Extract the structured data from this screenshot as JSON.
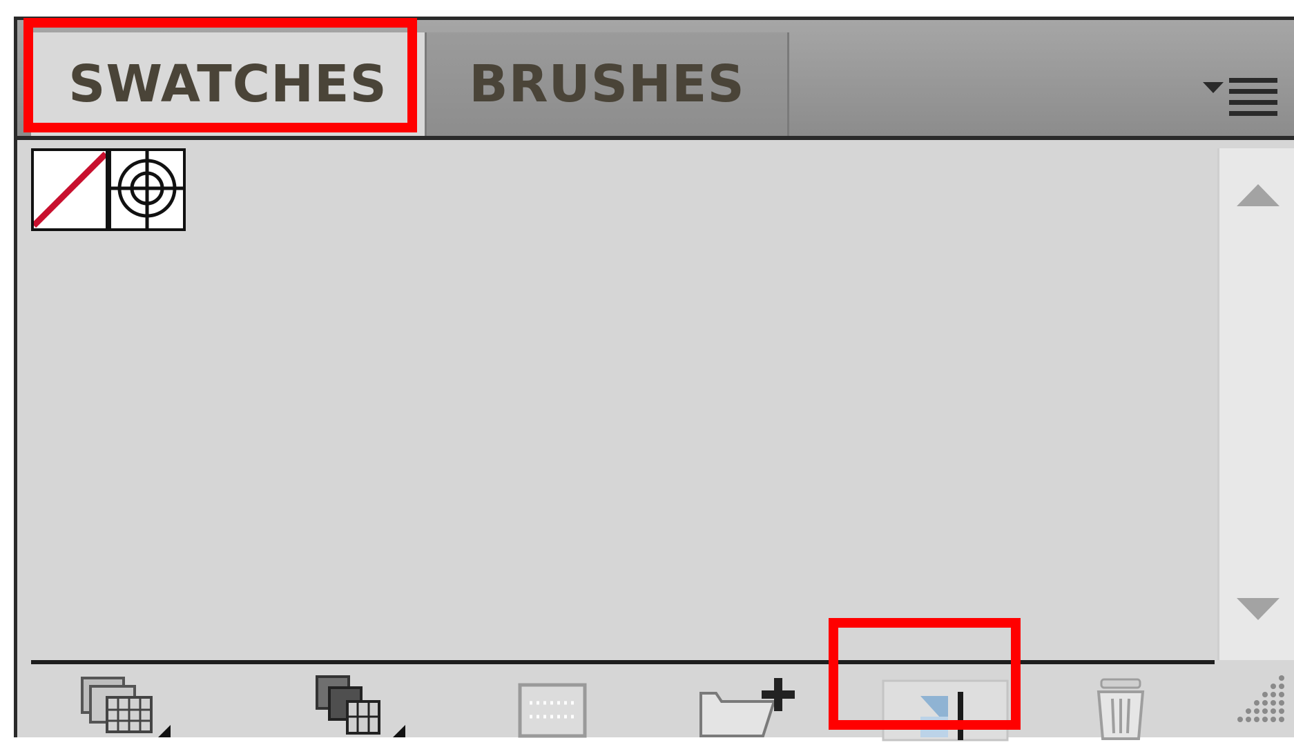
{
  "panel": {
    "tabs": [
      {
        "label": "SWATCHES",
        "active": true
      },
      {
        "label": "BRUSHES",
        "active": false
      }
    ],
    "menu_icon": "panel-flyout-menu-icon"
  },
  "swatches": [
    {
      "name": "[None]",
      "icon": "none-swatch-icon"
    },
    {
      "name": "[Registration]",
      "icon": "registration-swatch-icon"
    }
  ],
  "toolbar": {
    "buttons": [
      {
        "icon": "swatch-libraries-menu-icon",
        "has_submenu": true
      },
      {
        "icon": "show-swatch-kinds-menu-icon",
        "has_submenu": true
      },
      {
        "icon": "swatch-options-icon",
        "has_submenu": false
      },
      {
        "icon": "new-color-group-icon",
        "has_submenu": false
      },
      {
        "icon": "new-swatch-icon",
        "has_submenu": false,
        "highlighted": true
      },
      {
        "icon": "delete-swatch-icon",
        "has_submenu": false
      }
    ]
  },
  "colors": {
    "highlight": "#ff0000",
    "none_slash": "#c8102e",
    "panel_bg": "#d6d6d6",
    "tab_text": "#4a4438"
  }
}
